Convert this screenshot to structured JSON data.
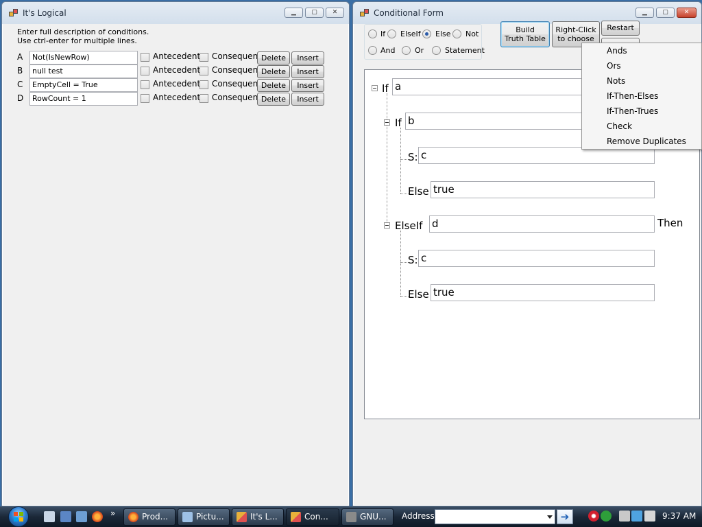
{
  "left_window": {
    "title": "It's Logical",
    "instructions": [
      "Enter full description of conditions.",
      "Use ctrl-enter for multiple lines."
    ],
    "rows": [
      {
        "letter": "A",
        "value": "Not(IsNewRow)"
      },
      {
        "letter": "B",
        "value": "null test"
      },
      {
        "letter": "C",
        "value": "EmptyCell = True"
      },
      {
        "letter": "D",
        "value": "RowCount = 1"
      }
    ],
    "antecedent_label": "Antecedent",
    "consequent_label": "Consequent",
    "delete_label": "Delete",
    "insert_label": "Insert"
  },
  "right_window": {
    "title": "Conditional Form",
    "radios": {
      "if": "If",
      "elseif": "ElseIf",
      "else": "Else",
      "not": "Not",
      "and": "And",
      "or": "Or",
      "statement": "Statement",
      "selected": "Else"
    },
    "buttons": {
      "build_line1": "Build",
      "build_line2": "Truth Table",
      "rightclick_line1": "Right-Click",
      "rightclick_line2": "to choose",
      "restart": "Restart"
    },
    "tree": {
      "if1_label": "If",
      "if1_value": "a",
      "if2_label": "If",
      "if2_value": "b",
      "s1_label": "S:",
      "s1_value": "c",
      "else1_label": "Else",
      "else1_value": "true",
      "elseif_label": "ElseIf",
      "elseif_value": "d",
      "then_label": "Then",
      "s2_label": "S:",
      "s2_value": "c",
      "else2_label": "Else",
      "else2_value": "true"
    }
  },
  "context_menu": {
    "items": [
      "Ands",
      "Ors",
      "Nots",
      "If-Then-Elses",
      "If-Then-Trues",
      "Check",
      "Remove Duplicates"
    ]
  },
  "taskbar": {
    "tasks": [
      "Prod...",
      "Pictu...",
      "It's L...",
      "Con...",
      "GNU..."
    ],
    "address_label": "Address",
    "clock": "9:37 AM"
  },
  "colors": {
    "desktop": "#3a6ea5",
    "window_bg": "#f0f0f0",
    "close_button": "#c6422c"
  }
}
